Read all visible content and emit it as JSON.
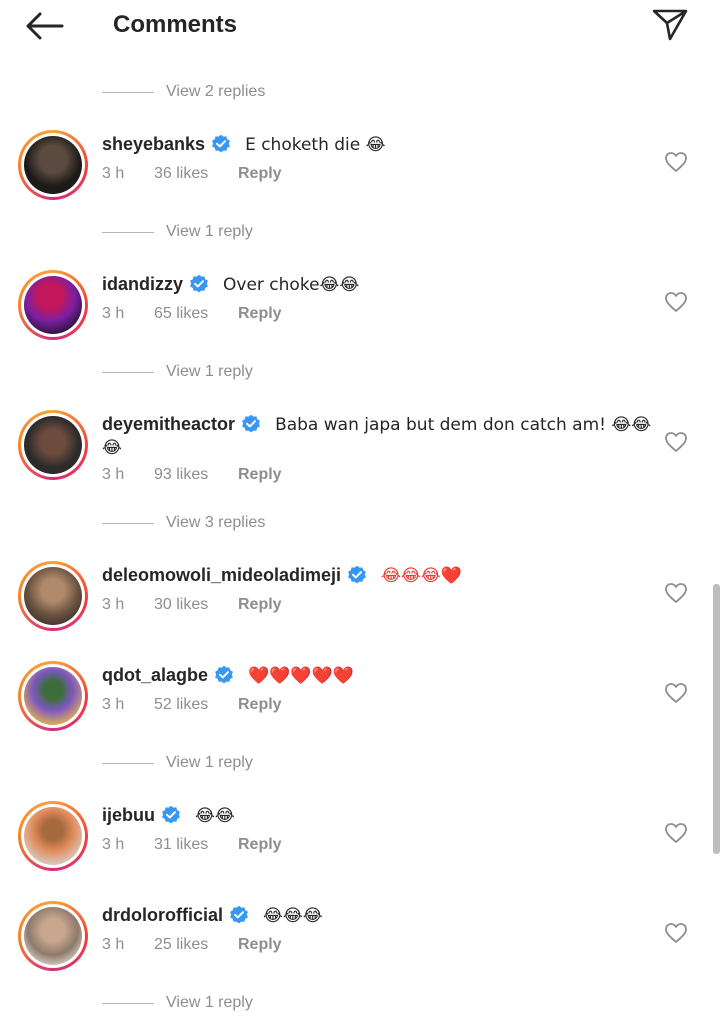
{
  "header": {
    "title": "Comments",
    "back_icon": "arrow-left-icon",
    "send_icon": "send-icon"
  },
  "view_replies": [
    "View 2 replies",
    "View 1 reply",
    "View 1 reply",
    "View 3 replies",
    "View 1 reply",
    "View 1 reply"
  ],
  "comments": [
    {
      "username": "sheyebanks",
      "text": "E choketh die 😂",
      "time": "3 h",
      "likes": "36 likes",
      "reply": "Reply",
      "verified": true
    },
    {
      "username": "idandizzy",
      "text": "Over choke😂😂",
      "time": "3 h",
      "likes": "65 likes",
      "reply": "Reply",
      "verified": true
    },
    {
      "username": "deyemitheactor",
      "text": "Baba wan japa but dem don catch am! 😂😂",
      "text2": "😂",
      "time": "3 h",
      "likes": "93 likes",
      "reply": "Reply",
      "verified": true
    },
    {
      "username": "deleomowoli_mideoladimeji",
      "text": "😂😂😂❤️",
      "time": "3 h",
      "likes": "30 likes",
      "reply": "Reply",
      "verified": true
    },
    {
      "username": "qdot_alagbe",
      "text": "❤️❤️❤️❤️❤️",
      "time": "3 h",
      "likes": "52 likes",
      "reply": "Reply",
      "verified": true
    },
    {
      "username": "ijebuu",
      "text": "😂😂",
      "time": "3 h",
      "likes": "31 likes",
      "reply": "Reply",
      "verified": true
    },
    {
      "username": "drdolorofficial",
      "text": "😂😂😂",
      "time": "3 h",
      "likes": "25 likes",
      "reply": "Reply",
      "verified": true
    }
  ],
  "colors": {
    "text": "#262626",
    "muted": "#8e8e8e",
    "verified": "#3897f0",
    "ring_start": "#f9a23a",
    "ring_end": "#d62d7a"
  }
}
